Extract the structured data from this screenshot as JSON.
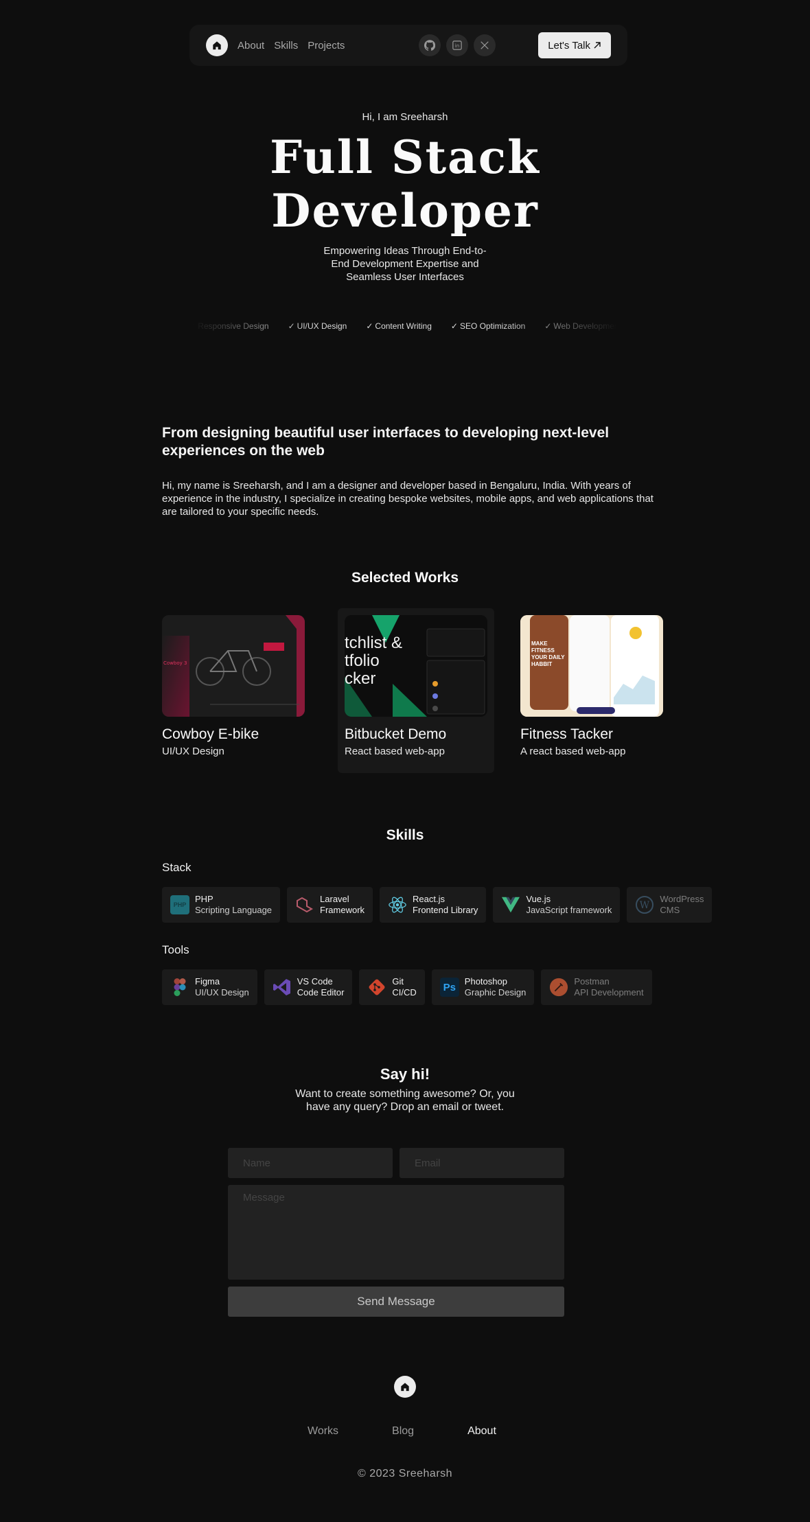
{
  "nav": {
    "links": [
      "About",
      "Skills",
      "Projects"
    ],
    "socials": [
      "github-icon",
      "linkedin-icon",
      "x-icon"
    ],
    "cta_label": "Let's Talk"
  },
  "hero": {
    "greeting": "Hi, I am Sreeharsh",
    "title_line1": "Full Stack",
    "title_line2": "Developer",
    "subtitle": "Empowering Ideas Through End-to-End Development Expertise and Seamless User Interfaces",
    "ticker": [
      "Responsive Design",
      "UI/UX Design",
      "Content Writing",
      "SEO Optimization",
      "Web Development"
    ]
  },
  "about": {
    "heading": "From designing beautiful user interfaces to developing next-level experiences on the web",
    "body": "Hi, my name is Sreeharsh, and I am a designer and developer based in Bengaluru, India. With years of experience in the industry, I specialize in creating bespoke websites, mobile apps, and web applications that are tailored to your specific needs."
  },
  "works": {
    "title": "Selected Works",
    "items": [
      {
        "title": "Cowboy E-bike",
        "subtitle": "UI/UX Design",
        "thumb_text": "Cowboy 3"
      },
      {
        "title": "Bitbucket Demo",
        "subtitle": "React based web-app",
        "thumb_text": "tchlist & tfolio cker"
      },
      {
        "title": "Fitness Tacker",
        "subtitle": "A react based web-app",
        "thumb_text": "MAKE FITNESS YOUR DAILY HABBIT"
      }
    ]
  },
  "skills": {
    "title": "Skills",
    "stack_label": "Stack",
    "stack": [
      {
        "name": "PHP",
        "desc": "Scripting Language",
        "icon": "php-icon",
        "color": "#1f6f7a"
      },
      {
        "name": "Laravel",
        "desc": "Framework",
        "icon": "laravel-icon",
        "color": "#b85b6b"
      },
      {
        "name": "React.js",
        "desc": "Frontend Library",
        "icon": "react-icon",
        "color": "#5fc9e0"
      },
      {
        "name": "Vue.js",
        "desc": "JavaScript framework",
        "icon": "vue-icon",
        "color": "#41b883"
      },
      {
        "name": "WordPress",
        "desc": "CMS",
        "icon": "wordpress-icon",
        "color": "#3a7aa3"
      }
    ],
    "tools_label": "Tools",
    "tools": [
      {
        "name": "Figma",
        "desc": "UI/UX Design",
        "icon": "figma-icon"
      },
      {
        "name": "VS Code",
        "desc": "Code Editor",
        "icon": "vscode-icon"
      },
      {
        "name": "Git",
        "desc": "CI/CD",
        "icon": "git-icon"
      },
      {
        "name": "Photoshop",
        "desc": "Graphic Design",
        "icon": "photoshop-icon",
        "glyph": "Ps"
      },
      {
        "name": "Postman",
        "desc": "API Development",
        "icon": "postman-icon"
      }
    ]
  },
  "contact": {
    "title": "Say hi!",
    "subtitle": "Want to create something awesome? Or, you have any query? Drop an email or tweet.",
    "name_placeholder": "Name",
    "email_placeholder": "Email",
    "message_placeholder": "Message",
    "send_label": "Send Message"
  },
  "footer": {
    "links": [
      "Works",
      "Blog",
      "About"
    ],
    "copyright": "©  2023  Sreeharsh"
  }
}
